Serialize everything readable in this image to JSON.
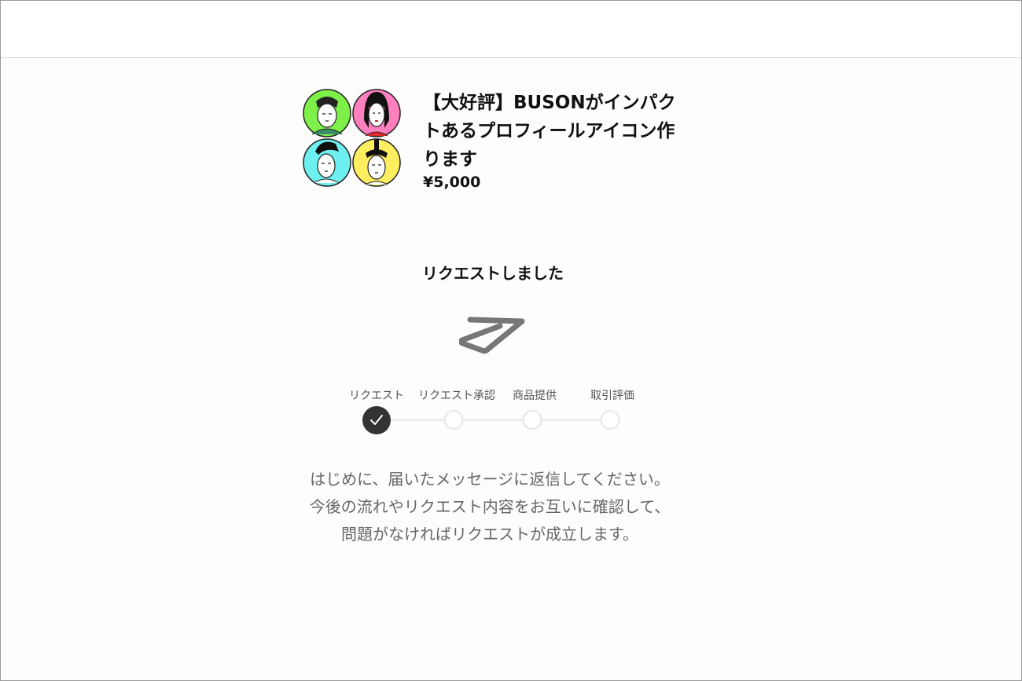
{
  "product": {
    "title": "【大好評】BUSONがインパクトあるプロフィールアイコン作ります",
    "price": "¥5,000",
    "thumbnail_colors": [
      "#7fef4a",
      "#ff7fbf",
      "#6ef0f0",
      "#ffef60"
    ]
  },
  "status": {
    "title": "リクエストしました",
    "icon": "paper-plane-icon"
  },
  "steps": [
    {
      "label": "リクエスト",
      "state": "done"
    },
    {
      "label": "リクエスト承認",
      "state": "pending"
    },
    {
      "label": "商品提供",
      "state": "pending"
    },
    {
      "label": "取引評価",
      "state": "pending"
    }
  ],
  "message": {
    "line1": "はじめに、届いたメッセージに返信してください。",
    "line2": "今後の流れやリクエスト内容をお互いに確認して、",
    "line3": "問題がなければリクエストが成立します。"
  }
}
